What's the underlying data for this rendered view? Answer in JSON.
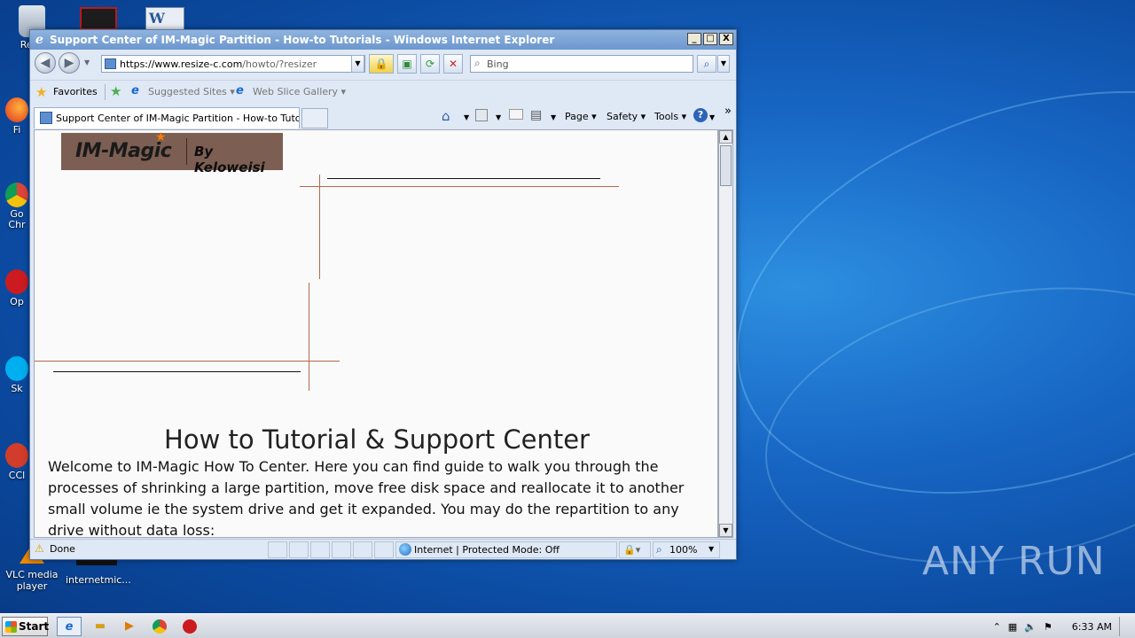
{
  "desktop": {
    "icons": [
      {
        "label": "Recy",
        "name": "recycle-bin-icon"
      },
      {
        "label": "Fi",
        "name": "firefox-icon"
      },
      {
        "label": "Go Chr",
        "name": "chrome-icon"
      },
      {
        "label": "Op",
        "name": "opera-icon"
      },
      {
        "label": "Sk",
        "name": "skype-icon"
      },
      {
        "label": "CCl",
        "name": "ccleaner-icon"
      },
      {
        "label": "VLC media player",
        "name": "vlc-icon"
      },
      {
        "label": "internetmic...",
        "name": "file-icon"
      }
    ],
    "watermark": "ANY RUN"
  },
  "window": {
    "title": "Support Center of IM-Magic Partition - How-to Tutorials - Windows Internet Explorer",
    "buttons": {
      "minimize": "_",
      "maximize": "□",
      "close": "X"
    }
  },
  "navbar": {
    "url_main": "https://www.resize-c.com",
    "url_rest": "/howto/?resizer",
    "search_placeholder": "Bing"
  },
  "favorites": {
    "favorites_label": "Favorites",
    "suggested_sites": "Suggested Sites ▾",
    "web_slice": "Web Slice Gallery ▾"
  },
  "tab": {
    "title": "Support Center of IM-Magic Partition - How-to Tutorials"
  },
  "commands": {
    "page": "Page ▾",
    "safety": "Safety ▾",
    "tools": "Tools ▾",
    "more": "»"
  },
  "page": {
    "logo_brand": "IM-Magic",
    "logo_by": "By Keloweisi",
    "heading": "How to Tutorial & Support Center",
    "paragraph": "Welcome to IM-Magic How To Center. Here you can find guide to walk you through the processes of shrinking a large partition, move free disk space and reallocate it to another small volume ie the system drive and get it expanded. You may do the repartition to any drive without data loss:"
  },
  "statusbar": {
    "status": "Done",
    "zone": "Internet | Protected Mode: Off",
    "zoom": "100%"
  },
  "taskbar": {
    "start": "Start",
    "time": "6:33 AM"
  },
  "colors": {
    "accent_line": "#b5694a",
    "ie_blue": "#1a6ad0"
  }
}
